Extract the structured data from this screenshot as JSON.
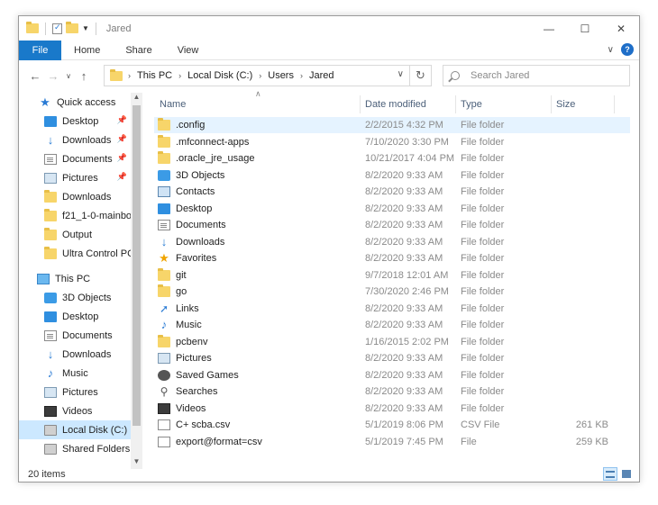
{
  "window": {
    "title": "Jared"
  },
  "ribbon": {
    "file_label": "File",
    "tabs": [
      "Home",
      "Share",
      "View"
    ],
    "help_label": "?"
  },
  "address": {
    "crumbs": [
      "This PC",
      "Local Disk (C:)",
      "Users",
      "Jared"
    ]
  },
  "search": {
    "placeholder": "Search Jared"
  },
  "nav": {
    "items": [
      {
        "label": "Quick access",
        "icon": "quick-access-star-icon",
        "pinned": false
      },
      {
        "label": "Desktop",
        "icon": "desktop-icon",
        "pinned": true
      },
      {
        "label": "Downloads",
        "icon": "downloads-icon",
        "pinned": true
      },
      {
        "label": "Documents",
        "icon": "documents-icon",
        "pinned": true
      },
      {
        "label": "Pictures",
        "icon": "pictures-icon",
        "pinned": true
      },
      {
        "label": "Downloads",
        "icon": "folder-icon",
        "pinned": false
      },
      {
        "label": "f21_1-0-mainbo",
        "icon": "folder-icon",
        "pinned": false
      },
      {
        "label": "Output",
        "icon": "folder-icon",
        "pinned": false
      },
      {
        "label": "Ultra Control PC",
        "icon": "folder-icon",
        "pinned": false
      },
      {
        "label": "This PC",
        "icon": "this-pc-icon",
        "pinned": false
      },
      {
        "label": "3D Objects",
        "icon": "3d-objects-icon",
        "pinned": false
      },
      {
        "label": "Desktop",
        "icon": "desktop-icon",
        "pinned": false
      },
      {
        "label": "Documents",
        "icon": "documents-icon",
        "pinned": false
      },
      {
        "label": "Downloads",
        "icon": "downloads-icon",
        "pinned": false
      },
      {
        "label": "Music",
        "icon": "music-icon",
        "pinned": false
      },
      {
        "label": "Pictures",
        "icon": "pictures-icon",
        "pinned": false
      },
      {
        "label": "Videos",
        "icon": "videos-icon",
        "pinned": false
      },
      {
        "label": "Local Disk (C:)",
        "icon": "drive-icon",
        "pinned": false,
        "selected": true
      },
      {
        "label": "Shared Folders (",
        "icon": "network-drive-icon",
        "pinned": false
      }
    ]
  },
  "columns": {
    "name": "Name",
    "date": "Date modified",
    "type": "Type",
    "size": "Size"
  },
  "files": [
    {
      "name": ".config",
      "date": "2/2/2015 4:32 PM",
      "type": "File folder",
      "size": "",
      "icon": "folder-icon",
      "selected": true
    },
    {
      "name": ".mfconnect-apps",
      "date": "7/10/2020 3:30 PM",
      "type": "File folder",
      "size": "",
      "icon": "folder-icon"
    },
    {
      "name": ".oracle_jre_usage",
      "date": "10/21/2017 4:04 PM",
      "type": "File folder",
      "size": "",
      "icon": "folder-icon"
    },
    {
      "name": "3D Objects",
      "date": "8/2/2020 9:33 AM",
      "type": "File folder",
      "size": "",
      "icon": "3d-objects-icon"
    },
    {
      "name": "Contacts",
      "date": "8/2/2020 9:33 AM",
      "type": "File folder",
      "size": "",
      "icon": "contacts-icon"
    },
    {
      "name": "Desktop",
      "date": "8/2/2020 9:33 AM",
      "type": "File folder",
      "size": "",
      "icon": "desktop-icon"
    },
    {
      "name": "Documents",
      "date": "8/2/2020 9:33 AM",
      "type": "File folder",
      "size": "",
      "icon": "documents-icon"
    },
    {
      "name": "Downloads",
      "date": "8/2/2020 9:33 AM",
      "type": "File folder",
      "size": "",
      "icon": "downloads-icon"
    },
    {
      "name": "Favorites",
      "date": "8/2/2020 9:33 AM",
      "type": "File folder",
      "size": "",
      "icon": "favorites-icon"
    },
    {
      "name": "git",
      "date": "9/7/2018 12:01 AM",
      "type": "File folder",
      "size": "",
      "icon": "folder-icon"
    },
    {
      "name": "go",
      "date": "7/30/2020 2:46 PM",
      "type": "File folder",
      "size": "",
      "icon": "folder-icon"
    },
    {
      "name": "Links",
      "date": "8/2/2020 9:33 AM",
      "type": "File folder",
      "size": "",
      "icon": "links-icon"
    },
    {
      "name": "Music",
      "date": "8/2/2020 9:33 AM",
      "type": "File folder",
      "size": "",
      "icon": "music-icon"
    },
    {
      "name": "pcbenv",
      "date": "1/16/2015 2:02 PM",
      "type": "File folder",
      "size": "",
      "icon": "folder-icon"
    },
    {
      "name": "Pictures",
      "date": "8/2/2020 9:33 AM",
      "type": "File folder",
      "size": "",
      "icon": "pictures-icon"
    },
    {
      "name": "Saved Games",
      "date": "8/2/2020 9:33 AM",
      "type": "File folder",
      "size": "",
      "icon": "saved-games-icon"
    },
    {
      "name": "Searches",
      "date": "8/2/2020 9:33 AM",
      "type": "File folder",
      "size": "",
      "icon": "searches-icon"
    },
    {
      "name": "Videos",
      "date": "8/2/2020 9:33 AM",
      "type": "File folder",
      "size": "",
      "icon": "videos-icon"
    },
    {
      "name": "C+ scba.csv",
      "date": "5/1/2019 8:06 PM",
      "type": "CSV File",
      "size": "261 KB",
      "icon": "csv-file-icon"
    },
    {
      "name": "export@format=csv",
      "date": "5/1/2019 7:45 PM",
      "type": "File",
      "size": "259 KB",
      "icon": "file-icon"
    }
  ],
  "status": {
    "count": "20 items"
  }
}
